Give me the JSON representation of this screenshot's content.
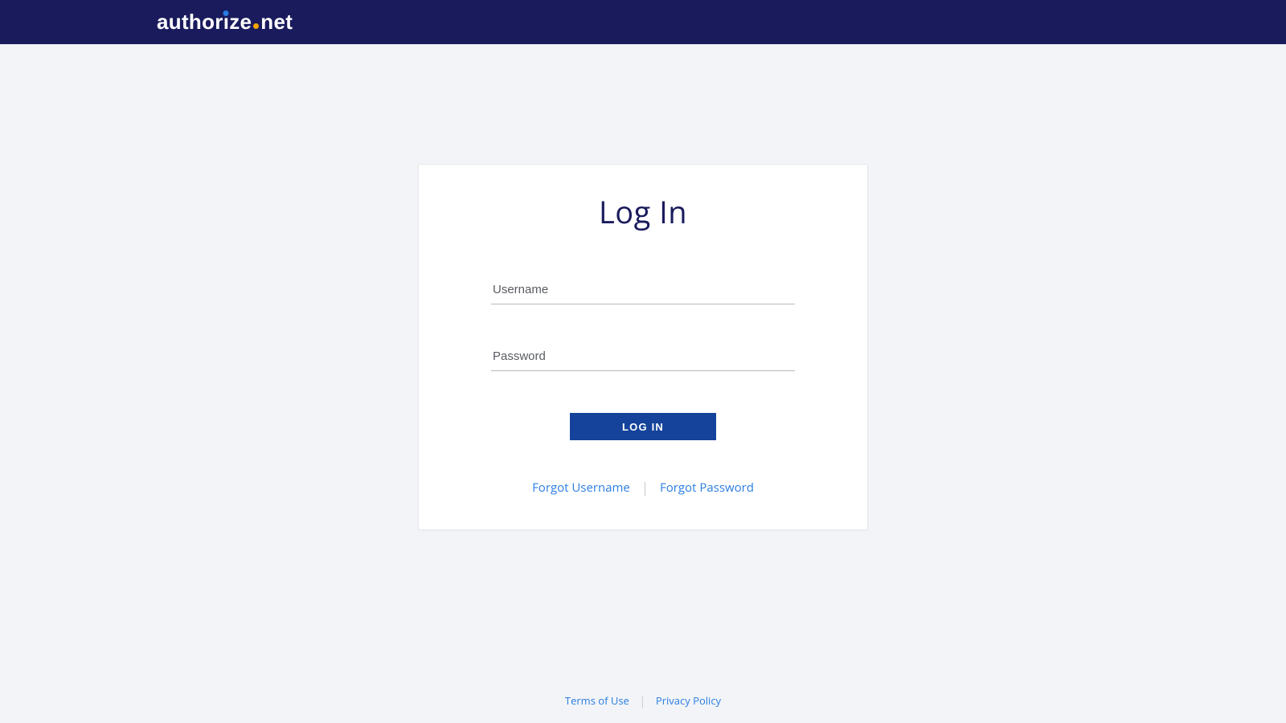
{
  "header": {
    "brand_full": "authorize.net"
  },
  "card": {
    "title": "Log In",
    "username_placeholder": "Username",
    "username_value": "",
    "password_placeholder": "Password",
    "password_value": "",
    "login_button_label": "LOG IN",
    "forgot_username_label": "Forgot Username",
    "forgot_password_label": "Forgot Password"
  },
  "footer": {
    "terms_label": "Terms of Use",
    "privacy_label": "Privacy Policy"
  },
  "colors": {
    "header_bg": "#1a1b5d",
    "page_bg": "#f2f4f8",
    "primary_button": "#15439b",
    "link": "#2a7de1",
    "accent_orange": "#f7a600"
  }
}
